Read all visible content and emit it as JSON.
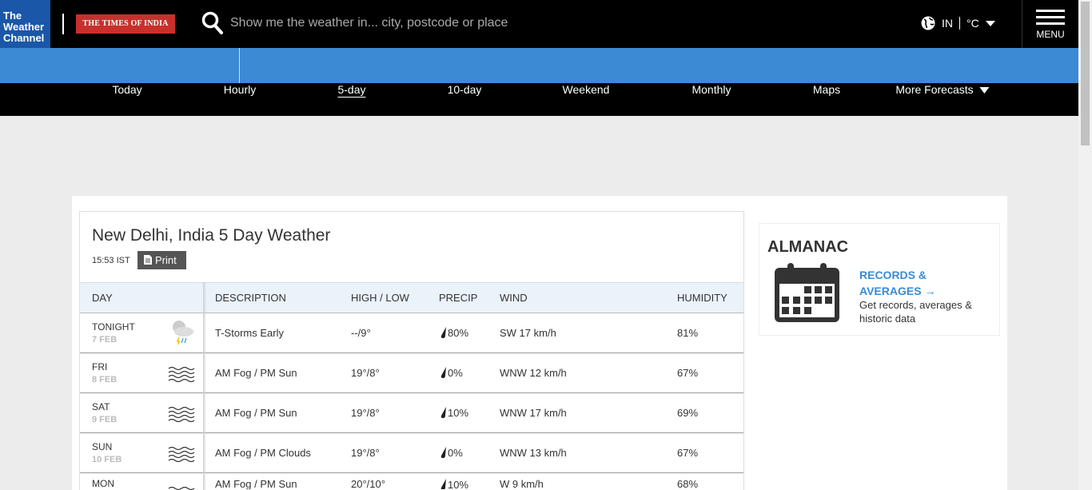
{
  "header": {
    "logo_text": "The Weather Channel",
    "partner_logo": "THE TIMES OF INDIA",
    "search_placeholder": "Show me the weather in... city, postcode or place",
    "region": "IN",
    "unit": "°C",
    "menu_label": "MENU"
  },
  "nav": {
    "active": "5-day",
    "items": [
      {
        "label": "Today"
      },
      {
        "label": "Hourly"
      },
      {
        "label": "5-day"
      },
      {
        "label": "10-day"
      },
      {
        "label": "Weekend"
      },
      {
        "label": "Monthly"
      },
      {
        "label": "Maps"
      },
      {
        "label": "More Forecasts"
      }
    ]
  },
  "forecast": {
    "title": "New Delhi, India 5 Day Weather",
    "time": "15:53 IST",
    "print_label": "Print",
    "columns": [
      "DAY",
      "DESCRIPTION",
      "HIGH / LOW",
      "PRECIP",
      "WIND",
      "HUMIDITY"
    ],
    "rows": [
      {
        "day": "TONIGHT",
        "date": "7 FEB",
        "icon": "thunderstorm-icon",
        "description": "T-Storms Early",
        "high_low": "--/9°",
        "precip": "80%",
        "wind": "SW 17 km/h",
        "humidity": "81%"
      },
      {
        "day": "FRI",
        "date": "8 FEB",
        "icon": "fog-icon",
        "description": "AM Fog / PM Sun",
        "high_low": "19°/8°",
        "precip": "0%",
        "wind": "WNW 12 km/h",
        "humidity": "67%"
      },
      {
        "day": "SAT",
        "date": "9 FEB",
        "icon": "fog-icon",
        "description": "AM Fog / PM Sun",
        "high_low": "19°/8°",
        "precip": "10%",
        "wind": "WNW 17 km/h",
        "humidity": "69%"
      },
      {
        "day": "SUN",
        "date": "10 FEB",
        "icon": "fog-icon",
        "description": "AM Fog / PM Clouds",
        "high_low": "19°/8°",
        "precip": "0%",
        "wind": "WNW 13 km/h",
        "humidity": "67%"
      },
      {
        "day": "MON",
        "date": "",
        "icon": "fog-icon",
        "description": "AM Fog / PM Sun",
        "high_low": "20°/10°",
        "precip": "10%",
        "wind": "W 9 km/h",
        "humidity": "68%"
      }
    ]
  },
  "almanac": {
    "title": "ALMANAC",
    "link": "RECORDS & AVERAGES",
    "description": "Get records, averages & historic data"
  },
  "colors": {
    "brand_blue": "#1a57a8",
    "accent_blue": "#3b8ad3",
    "partner_red": "#c9302c"
  }
}
